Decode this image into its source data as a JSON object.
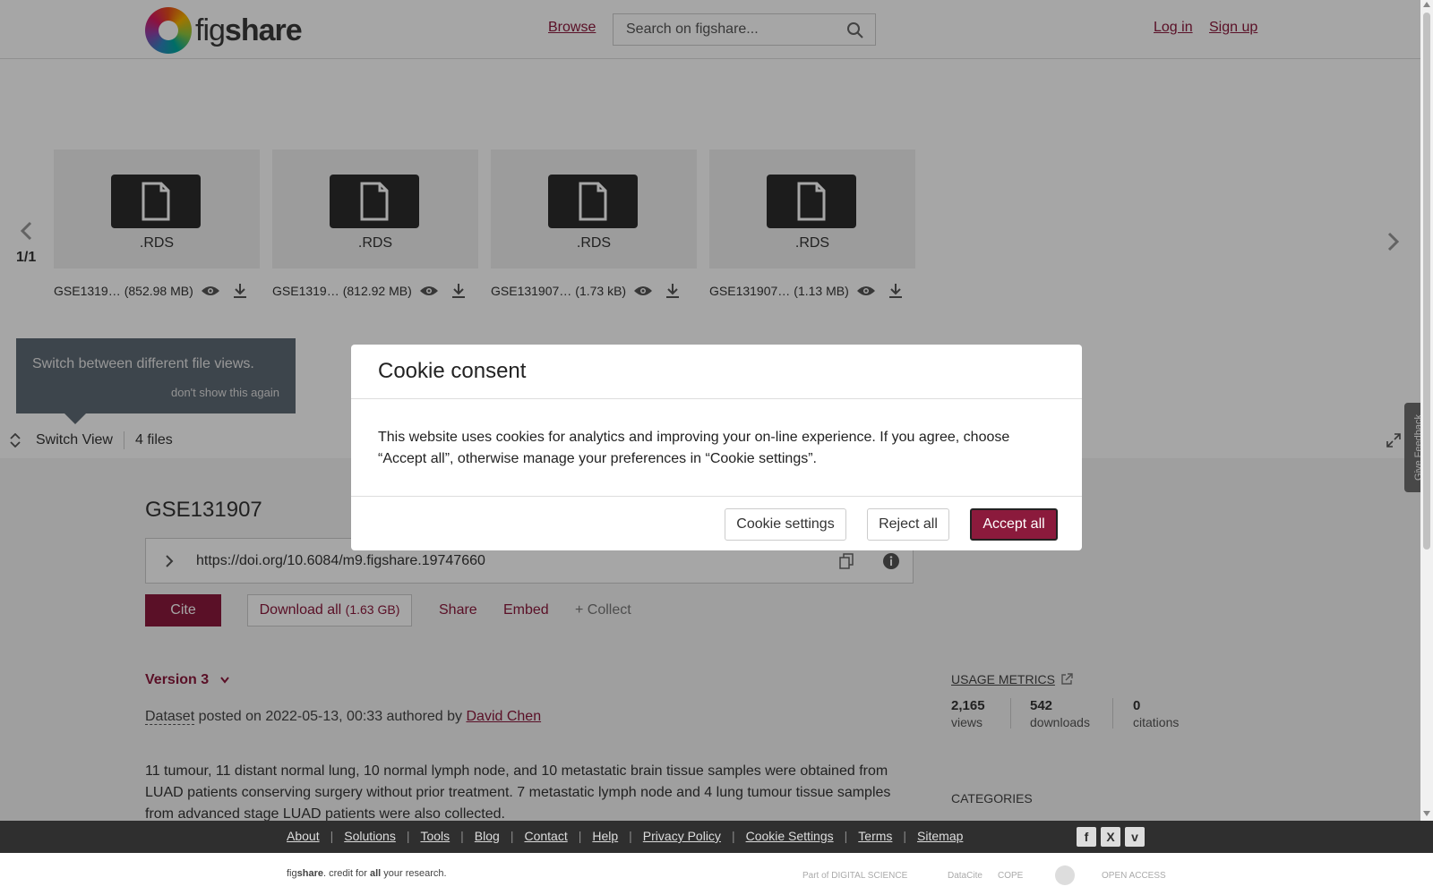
{
  "header": {
    "logo_text_light": "fig",
    "logo_text_bold": "share",
    "browse": "Browse",
    "search_placeholder": "Search on figshare...",
    "login": "Log in",
    "signup": "Sign up"
  },
  "carousel": {
    "page_indicator": "1/1",
    "files": [
      {
        "ext": ".RDS",
        "name": "GSE1319…",
        "size": "(852.98 MB)"
      },
      {
        "ext": ".RDS",
        "name": "GSE1319…",
        "size": "(812.92 MB)"
      },
      {
        "ext": ".RDS",
        "name": "GSE131907…",
        "size": "(1.73 kB)"
      },
      {
        "ext": ".RDS",
        "name": "GSE131907…",
        "size": "(1.13 MB)"
      }
    ]
  },
  "tooltip": {
    "text": "Switch between different file views.",
    "dismiss": "don't show this again"
  },
  "viewbar": {
    "switch_view": "Switch View",
    "file_count": "4 files"
  },
  "item": {
    "title": "GSE131907",
    "doi": "https://doi.org/10.6084/m9.figshare.19747660",
    "cite": "Cite",
    "download_all": "Download all",
    "download_size": "(1.63 GB)",
    "share": "Share",
    "embed": "Embed",
    "collect": "+ Collect",
    "version": "Version 3",
    "item_type": "Dataset",
    "posted_text": " posted on 2022-05-13, 00:33 authored by ",
    "author": "David Chen",
    "description": "11 tumour, 11 distant normal lung, 10 normal lymph node, and 10 metastatic brain tissue samples were obtained from LUAD patients conserving surgery without prior treatment. 7 metastatic lymph node and 4 lung tumour tissue samples from advanced stage LUAD patients were also collected."
  },
  "metrics": {
    "title": "USAGE METRICS",
    "views_value": "2,165",
    "views_label": "views",
    "downloads_value": "542",
    "downloads_label": "downloads",
    "citations_value": "0",
    "citations_label": "citations",
    "categories_title": "CATEGORIES"
  },
  "feedback": "Give Feedback",
  "cookie_modal": {
    "title": "Cookie consent",
    "body": "This website uses cookies for analytics and improving your on-line experience. If you agree, choose “Accept all”, otherwise manage your preferences in “Cookie settings”.",
    "settings": "Cookie settings",
    "reject": "Reject all",
    "accept": "Accept all"
  },
  "footer": {
    "links": [
      "About",
      "Solutions",
      "Tools",
      "Blog",
      "Contact",
      "Help",
      "Privacy Policy",
      "Cookie Settings",
      "Terms",
      "Sitemap"
    ],
    "social": [
      "f",
      "X",
      "v"
    ],
    "tagline_brand_light": "fig",
    "tagline_brand_bold": "share",
    "tagline_rest_1": ". credit for ",
    "tagline_bold_all": "all",
    "tagline_rest_2": " your research.",
    "partners": [
      "Part of DIGITAL SCIENCE",
      "DataCite",
      "COPE",
      "",
      "OPEN ACCESS"
    ]
  },
  "colors": {
    "brand": "#8b1a3c",
    "footer_bg": "#2f2f2f"
  }
}
